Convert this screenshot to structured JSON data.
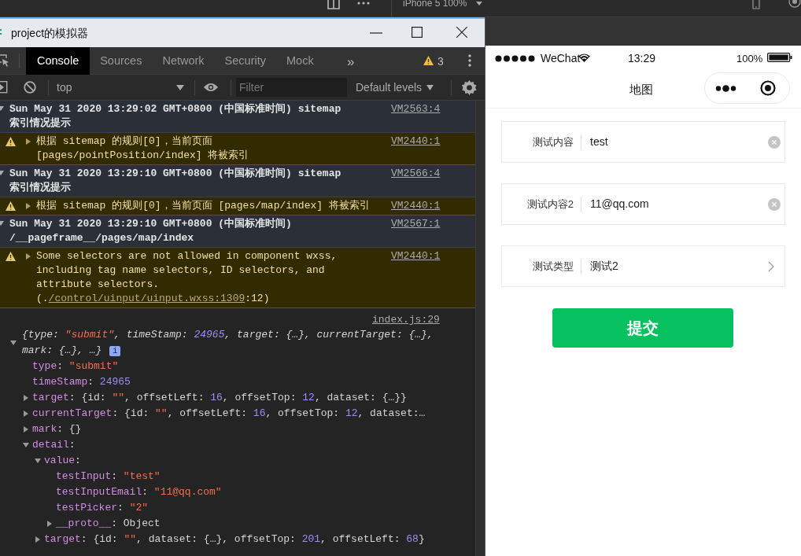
{
  "top_bar": {
    "device": "iPhone 5 100%"
  },
  "devtools": {
    "window_title": "project的模拟器",
    "tabs": [
      {
        "label": "Console",
        "selected": true
      },
      {
        "label": "Sources",
        "selected": false
      },
      {
        "label": "Network",
        "selected": false
      },
      {
        "label": "Security",
        "selected": false
      },
      {
        "label": "Mock",
        "selected": false
      }
    ],
    "more_tabs": "»",
    "warning_count": "3",
    "context": "top",
    "filter_placeholder": "Filter",
    "levels": "Default levels",
    "entries": [
      {
        "kind": "group",
        "expanded": true,
        "text": "Sun May 31 2020 13:29:02 GMT+0800 (中国标准时间) sitemap 索引情况提示",
        "source": "VM2563:4"
      },
      {
        "kind": "warning",
        "expanded": false,
        "text": "根据 sitemap 的规则[0]，当前页面 [pages/pointPosition/index] 将被索引",
        "source": "VM2440:1"
      },
      {
        "kind": "group",
        "expanded": true,
        "text": "Sun May 31 2020 13:29:10 GMT+0800 (中国标准时间) sitemap 索引情况提示",
        "source": "VM2566:4"
      },
      {
        "kind": "warning",
        "expanded": false,
        "text": "根据 sitemap 的规则[0]，当前页面 [pages/map/index] 将被索引",
        "source": "VM2440:1"
      },
      {
        "kind": "group",
        "expanded": true,
        "text": "Sun May 31 2020 13:29:10 GMT+0800 (中国标准时间) /__pageframe__/pages/map/index",
        "source": "VM2567:1"
      },
      {
        "kind": "warning",
        "expanded": false,
        "text": "Some selectors are not allowed in component wxss, including tag name selectors, ID selectors, and attribute selectors.(.",
        "link": "/control/uinput/uinput.wxss:1309",
        "text_after": ":12)",
        "source": "VM2440:1"
      },
      {
        "kind": "log",
        "expanded": true,
        "source": "index.js:29",
        "badge": "i",
        "summary": [
          {
            "kind": "plain",
            "text": "{type: "
          },
          {
            "kind": "string",
            "text": "\"submit\""
          },
          {
            "kind": "plain",
            "text": ", timeStamp: "
          },
          {
            "kind": "number",
            "text": "24965"
          },
          {
            "kind": "plain",
            "text": ", target: {…}, currentTarget: {…}, mark: {…}, …}"
          }
        ],
        "properties": [
          {
            "key": "type",
            "value": [
              {
                "kind": "plain",
                "text": ": "
              },
              {
                "kind": "string",
                "text": "\"submit\""
              }
            ]
          },
          {
            "key": "timeStamp",
            "value": [
              {
                "kind": "plain",
                "text": ": "
              },
              {
                "kind": "number",
                "text": "24965"
              }
            ]
          },
          {
            "key": "target",
            "expanded": false,
            "value": [
              {
                "kind": "plain",
                "text": ": {id: "
              },
              {
                "kind": "string",
                "text": "\"\""
              },
              {
                "kind": "plain",
                "text": ", offsetLeft: "
              },
              {
                "kind": "number",
                "text": "16"
              },
              {
                "kind": "plain",
                "text": ", offsetTop: "
              },
              {
                "kind": "number",
                "text": "12"
              },
              {
                "kind": "plain",
                "text": ", dataset: {…}}"
              }
            ]
          },
          {
            "key": "currentTarget",
            "expanded": false,
            "value": [
              {
                "kind": "plain",
                "text": ": {id: "
              },
              {
                "kind": "string",
                "text": "\"\""
              },
              {
                "kind": "plain",
                "text": ", offsetLeft: "
              },
              {
                "kind": "number",
                "text": "16"
              },
              {
                "kind": "plain",
                "text": ", offsetTop: "
              },
              {
                "kind": "number",
                "text": "12"
              },
              {
                "kind": "plain",
                "text": ", dataset:…"
              }
            ]
          },
          {
            "key": "mark",
            "expanded": false,
            "value": [
              {
                "kind": "plain",
                "text": ": {}"
              }
            ]
          },
          {
            "key": "detail",
            "expanded": true,
            "value": [
              {
                "kind": "plain",
                "text": ":"
              }
            ],
            "children": [
              {
                "key": "value",
                "expanded": true,
                "value": [
                  {
                    "kind": "plain",
                    "text": ":"
                  }
                ],
                "children": [
                  {
                    "key": "testInput",
                    "value": [
                      {
                        "kind": "plain",
                        "text": ": "
                      },
                      {
                        "kind": "string",
                        "text": "\"test\""
                      }
                    ]
                  },
                  {
                    "key": "testInputEmail",
                    "value": [
                      {
                        "kind": "plain",
                        "text": ": "
                      },
                      {
                        "kind": "string",
                        "text": "\"11@qq.com\""
                      }
                    ]
                  },
                  {
                    "key": "testPicker",
                    "value": [
                      {
                        "kind": "plain",
                        "text": ": "
                      },
                      {
                        "kind": "string",
                        "text": "\"2\""
                      }
                    ]
                  },
                  {
                    "key": "__proto__",
                    "expanded": false,
                    "value": [
                      {
                        "kind": "plain",
                        "text": ": Object"
                      }
                    ]
                  }
                ]
              },
              {
                "key": "target",
                "expanded": false,
                "value": [
                  {
                    "kind": "plain",
                    "text": ": {id: "
                  },
                  {
                    "kind": "string",
                    "text": "\"\""
                  },
                  {
                    "kind": "plain",
                    "text": ", dataset: {…}, offsetTop: "
                  },
                  {
                    "kind": "number",
                    "text": "201"
                  },
                  {
                    "kind": "plain",
                    "text": ", offsetLeft: "
                  },
                  {
                    "kind": "number",
                    "text": "68"
                  },
                  {
                    "kind": "plain",
                    "text": "}"
                  }
                ]
              }
            ]
          }
        ]
      }
    ]
  },
  "phone": {
    "carrier": "WeChat",
    "time": "13:29",
    "battery": "100%",
    "title": "地图",
    "fields": [
      {
        "kind": "input",
        "label": "测试内容",
        "value": "test"
      },
      {
        "kind": "input",
        "label": "测试内容2",
        "value": "11@qq.com"
      },
      {
        "kind": "picker",
        "label": "测试类型",
        "value": "测试2"
      }
    ],
    "submit": "提交"
  }
}
